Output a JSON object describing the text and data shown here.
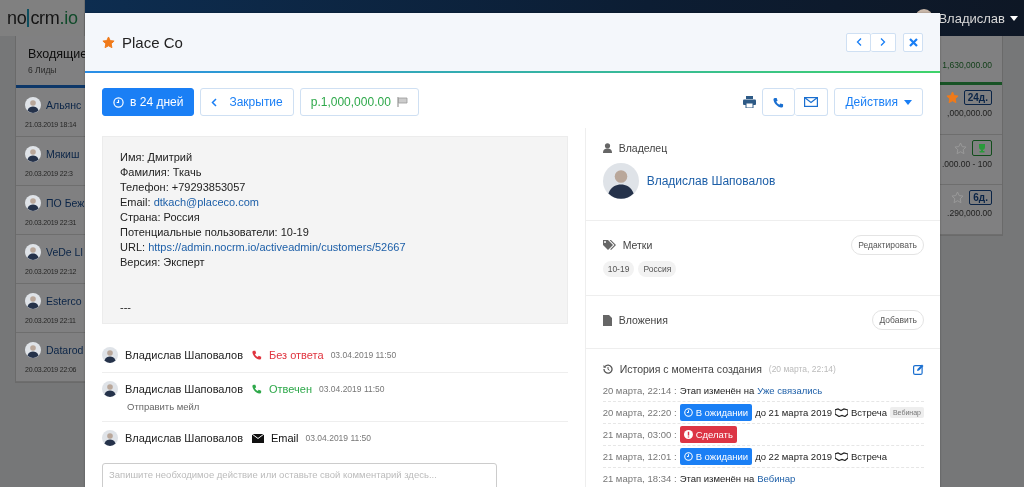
{
  "background": {
    "logo": [
      "no",
      "crm",
      ".io"
    ],
    "user_name": "Владислав",
    "column": {
      "title": "Входящие",
      "count": "6 Лиды",
      "items": [
        {
          "name": "Альянс",
          "date": "21.03.2019 18:14"
        },
        {
          "name": "Мякиш",
          "date": "20.03.2019 22:3"
        },
        {
          "name": "ПО Беж",
          "date": "20.03.2019 22:31"
        },
        {
          "name": "VeDe Ll",
          "date": "20.03.2019 22:12"
        },
        {
          "name": "Esterco",
          "date": "20.03.2019 22:11"
        },
        {
          "name": "Datarod",
          "date": "20.03.2019 22:06"
        }
      ]
    },
    "right_column": {
      "total": "1,630,000.00",
      "items": [
        {
          "starred": true,
          "kind": "days",
          "badge": "24д.",
          "amount": ",000,000.00"
        },
        {
          "starred": false,
          "kind": "trophy",
          "amount": ".000.00 - 100"
        },
        {
          "starred": false,
          "kind": "days",
          "badge": "6д.",
          "amount": ".290,000.00"
        }
      ]
    }
  },
  "lead": {
    "starred": true,
    "title": "Place Co"
  },
  "toolbar": {
    "deadline": "в 24 дней",
    "step": "Закрытие",
    "amount": "р.1,000,000.00",
    "actions": "Действия"
  },
  "description": {
    "lines": [
      {
        "text": "Имя: Дмитрий"
      },
      {
        "text": "Фамилия: Ткачь"
      },
      {
        "text": "Телефон: +79293853057"
      },
      {
        "text": "Email:",
        "link": "dtkach@placeco.com"
      },
      {
        "text": "Страна: Россия"
      },
      {
        "text": "Потенциальные пользователи: 10-19"
      },
      {
        "text": "URL:",
        "link": "https://admin.nocrm.io/activeadmin/customers/52667"
      },
      {
        "text": "Версия: Эксперт"
      }
    ],
    "signature": "---"
  },
  "activities": [
    {
      "author": "Владислав Шаповалов",
      "kind": "call",
      "answered": false,
      "status": "Без ответа",
      "time": "03.04.2019 11:50"
    },
    {
      "author": "Владислав Шаповалов",
      "kind": "call",
      "answered": true,
      "status": "Отвечен",
      "time": "03.04.2019 11:50",
      "note": "Отправить мейл"
    },
    {
      "author": "Владислав Шаповалов",
      "kind": "email",
      "status": "Email",
      "time": "03.04.2019 11:50"
    }
  ],
  "comment": {
    "placeholder": "Запишите необходимое действие или оставьте свой комментарий здесь..."
  },
  "owner": {
    "label": "Владелец",
    "name": "Владислав Шаповалов"
  },
  "tags": {
    "label": "Метки",
    "edit": "Редактировать",
    "items": [
      "10-19",
      "Россия"
    ]
  },
  "attachments": {
    "label": "Вложения",
    "add": "Добавить"
  },
  "history": {
    "title": "История с момента создания",
    "since": "(20 марта, 22:14)",
    "entries": [
      {
        "time": "20 марта, 22:14 :",
        "segments": [
          {
            "kind": "text",
            "text": "Этап изменён на"
          },
          {
            "kind": "link",
            "text": "Уже связались"
          }
        ]
      },
      {
        "time": "20 марта, 22:20 :",
        "segments": [
          {
            "kind": "waiting",
            "text": "В ожидании"
          },
          {
            "kind": "text",
            "text": "до 21 марта 2019"
          },
          {
            "kind": "meeting",
            "text": "Встреча"
          },
          {
            "kind": "tag",
            "text": "Вебинар"
          }
        ]
      },
      {
        "time": "21 марта, 03:00 :",
        "segments": [
          {
            "kind": "todo",
            "text": "Сделать"
          }
        ]
      },
      {
        "time": "21 марта, 12:01 :",
        "segments": [
          {
            "kind": "waiting",
            "text": "В ожидании"
          },
          {
            "kind": "text",
            "text": "до 22 марта 2019"
          },
          {
            "kind": "meeting",
            "text": "Встреча"
          }
        ]
      },
      {
        "time": "21 марта, 18:34 :",
        "segments": [
          {
            "kind": "text",
            "text": "Этап изменён на"
          },
          {
            "kind": "link",
            "text": "Вебинар"
          }
        ]
      }
    ]
  }
}
